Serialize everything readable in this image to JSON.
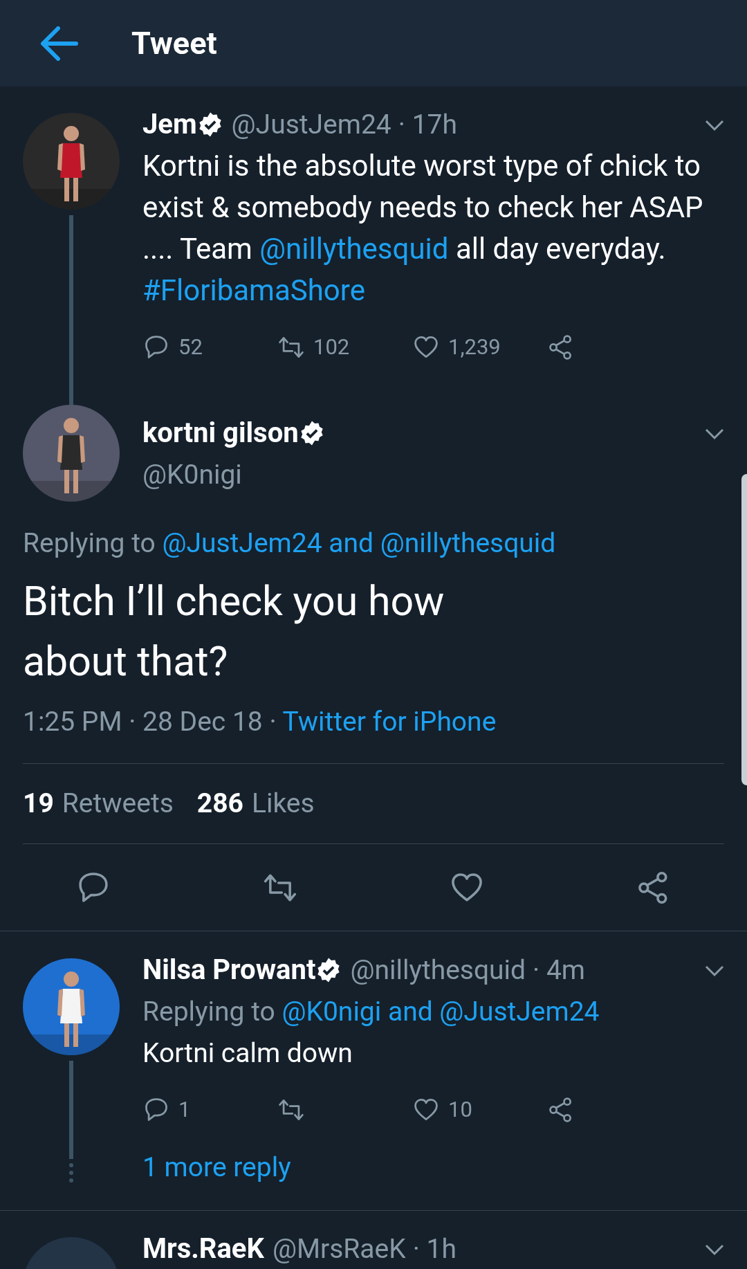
{
  "header": {
    "title": "Tweet"
  },
  "parent_tweet": {
    "name": "Jem",
    "verified": true,
    "handle": "@JustJem24",
    "time": "· 17h",
    "text": [
      {
        "text": "Kortni is the absolute worst type of chick to exist & somebody needs to check her ASAP .... Team ",
        "link": false
      },
      {
        "text": "@nillythesquid",
        "link": true
      },
      {
        "text": " all day everyday. ",
        "link": false
      },
      {
        "text": "#FloribamaShore",
        "link": true
      }
    ],
    "actions": [
      {
        "kind": "reply",
        "count": "52"
      },
      {
        "kind": "retweet",
        "count": "102"
      },
      {
        "kind": "like",
        "count": "1,239"
      },
      {
        "kind": "share"
      }
    ]
  },
  "main_tweet": {
    "name": "kortni gilson",
    "verified": true,
    "handle": "@K0nigi",
    "replying_to": [
      {
        "text": "Replying to ",
        "link": false
      },
      {
        "text": "@JustJem24 and @nillythesquid",
        "link": true
      }
    ],
    "text": "Bitch I’ll check you how about that?",
    "timestamp": [
      {
        "text": "1:25 PM · 28 Dec 18 · ",
        "link": false
      },
      {
        "text": "Twitter for iPhone",
        "link": true
      }
    ],
    "stats": [
      {
        "count": "19",
        "label": "Retweets"
      },
      {
        "count": "286",
        "label": "Likes"
      }
    ],
    "actions": [
      {
        "kind": "reply"
      },
      {
        "kind": "retweet"
      },
      {
        "kind": "like"
      },
      {
        "kind": "share"
      }
    ]
  },
  "reply_tweet": {
    "name": "Nilsa Prowant",
    "verified": true,
    "handle": "@nillythesquid",
    "time": "· 4m",
    "replying_to": [
      {
        "text": "Replying to ",
        "link": false
      },
      {
        "text": "@K0nigi and @JustJem24",
        "link": true
      }
    ],
    "text": [
      {
        "text": "Kortni calm down",
        "link": false
      }
    ],
    "actions": [
      {
        "kind": "reply",
        "count": "1"
      },
      {
        "kind": "retweet"
      },
      {
        "kind": "like",
        "count": "10"
      },
      {
        "kind": "share"
      }
    ],
    "more_replies": "1 more reply"
  },
  "next_tweet": {
    "name": "Mrs.RaeK",
    "verified": false,
    "handle": "@MrsRaeK",
    "time": "· 1h"
  }
}
